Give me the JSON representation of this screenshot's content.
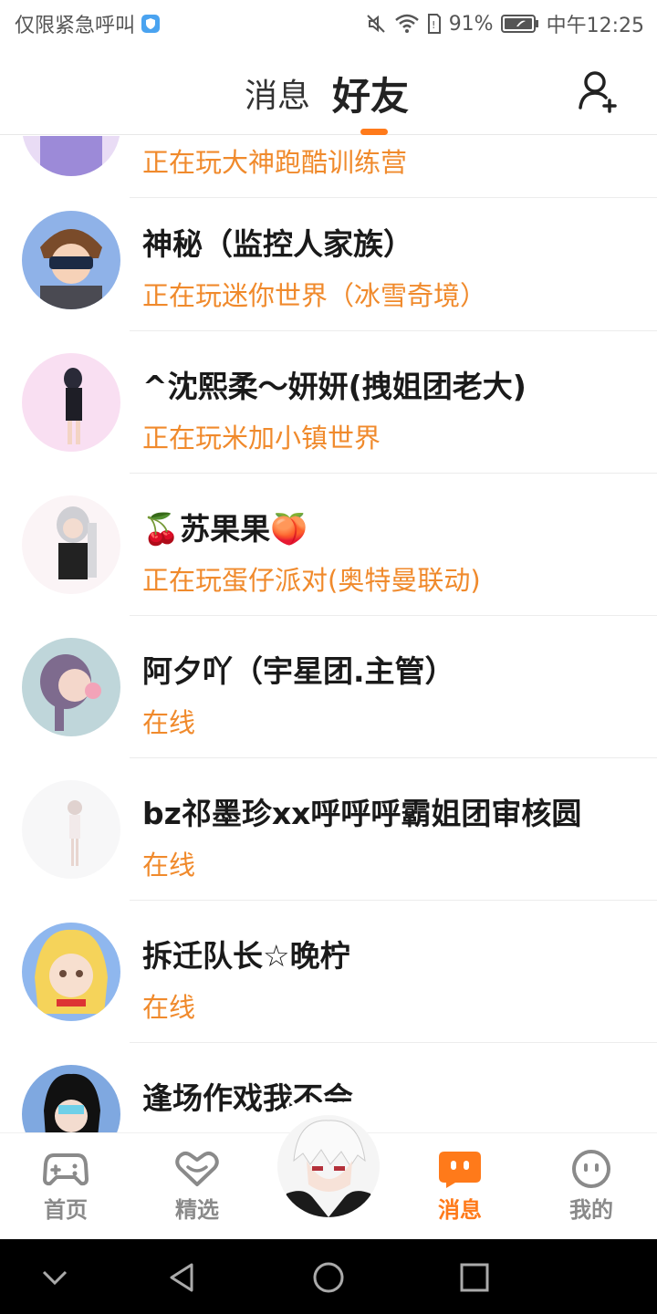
{
  "status_bar": {
    "left_text": "仅限紧急呼叫",
    "battery": "91%",
    "time": "中午12:25"
  },
  "header": {
    "tab_messages": "消息",
    "tab_friends": "好友",
    "accent": "#ff7a1a"
  },
  "friends": [
    {
      "name": "",
      "status": "正在玩大神跑酷训练营"
    },
    {
      "name": "神秘（监控人家族）",
      "status": "正在玩迷你世界（冰雪奇境）"
    },
    {
      "name": "^沈熙柔～妍妍(拽姐团老大)",
      "status": "正在玩米加小镇世界"
    },
    {
      "name": "🍒苏果果🍑",
      "status": "正在玩蛋仔派对(奥特曼联动)"
    },
    {
      "name": "阿夕吖（宇星团.主管）",
      "status": "在线"
    },
    {
      "name": "bz祁墨珍xx呼呼呼霸姐团审核圆",
      "status": "在线"
    },
    {
      "name": "拆迁队长☆晚柠",
      "status": "在线"
    },
    {
      "name": "逢场作戏我不会",
      "status": ""
    }
  ],
  "bottom_nav": {
    "home": "首页",
    "featured": "精选",
    "messages": "消息",
    "mine": "我的"
  },
  "icons": {
    "status_left": "shield-icon",
    "status_right": [
      "mute-icon",
      "wifi-icon",
      "sim-icon",
      "battery-icon"
    ],
    "header": "add-friend-icon",
    "nav": [
      "gamepad-icon",
      "heart-icon",
      "message-icon",
      "face-icon"
    ],
    "system": [
      "chevron-down-icon",
      "back-icon",
      "home-circle-icon",
      "recents-square-icon"
    ]
  }
}
